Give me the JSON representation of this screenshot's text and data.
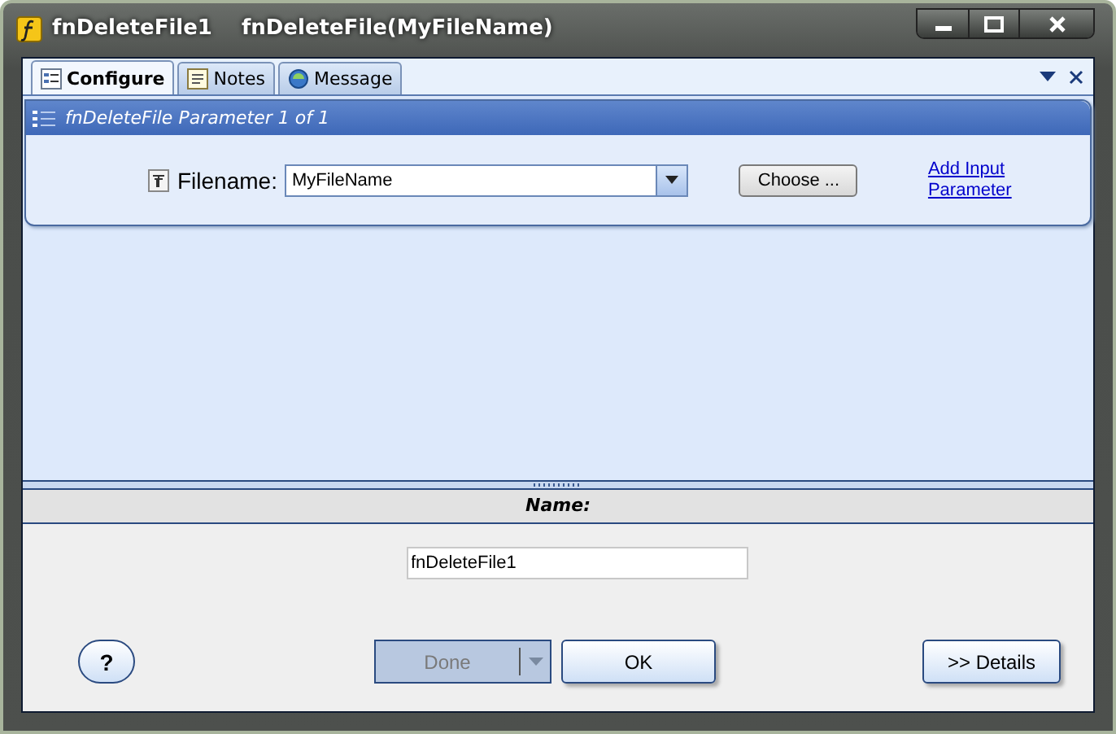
{
  "window": {
    "title": "fnDeleteFile1",
    "subtitle": "fnDeleteFile(MyFileName)"
  },
  "tabs": [
    {
      "label": "Configure",
      "selected": true,
      "kind": "configure"
    },
    {
      "label": "Notes",
      "selected": false,
      "kind": "notes"
    },
    {
      "label": "Message",
      "selected": false,
      "kind": "message"
    }
  ],
  "parameter_panel": {
    "title": "fnDeleteFile Parameter 1 of 1",
    "label": "Filename:",
    "value": "MyFileName",
    "choose_button": "Choose ...",
    "link": "Add Input Parameter"
  },
  "name_section": {
    "heading": "Name:",
    "value": "fnDeleteFile1"
  },
  "buttons": {
    "help": "?",
    "done": {
      "label": "Done",
      "disabled": true
    },
    "ok": "OK",
    "details": ">> Details"
  }
}
